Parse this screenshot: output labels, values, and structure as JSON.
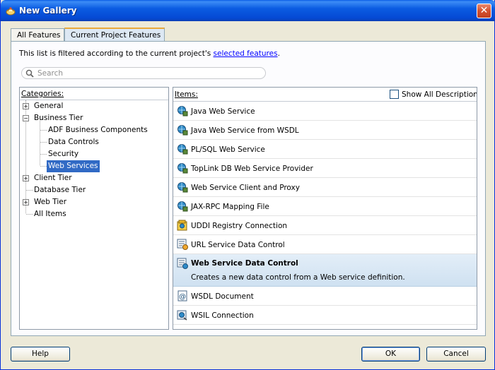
{
  "window": {
    "title": "New Gallery",
    "close_label": "✕"
  },
  "tabs": [
    {
      "label": "All Features",
      "selected": false
    },
    {
      "label": "Current Project Features",
      "selected": true
    }
  ],
  "filter_note": {
    "text": "This list is filtered according to the current project's ",
    "link": "selected features",
    "suffix": "."
  },
  "search": {
    "placeholder": "Search",
    "value": ""
  },
  "categories": {
    "header": "Categories:",
    "items": [
      {
        "label": "General",
        "level": 0,
        "expander": "+",
        "selected": false
      },
      {
        "label": "Business Tier",
        "level": 0,
        "expander": "−",
        "selected": false
      },
      {
        "label": "ADF Business Components",
        "level": 1,
        "expander": "",
        "selected": false
      },
      {
        "label": "Data Controls",
        "level": 1,
        "expander": "",
        "selected": false
      },
      {
        "label": "Security",
        "level": 1,
        "expander": "",
        "selected": false
      },
      {
        "label": "Web Services",
        "level": 1,
        "expander": "",
        "selected": true
      },
      {
        "label": "Client Tier",
        "level": 0,
        "expander": "+",
        "selected": false
      },
      {
        "label": "Database Tier",
        "level": 0,
        "expander": "",
        "selected": false
      },
      {
        "label": "Web Tier",
        "level": 0,
        "expander": "+",
        "selected": false
      },
      {
        "label": "All Items",
        "level": 0,
        "expander": "",
        "selected": false
      }
    ]
  },
  "items": {
    "header": "Items:",
    "show_all_descriptions": "Show All Descriptions",
    "show_all_checked": false,
    "list": [
      {
        "label": "Java Web Service",
        "icon": "web-service-icon"
      },
      {
        "label": "Java Web Service from WSDL",
        "icon": "web-service-icon"
      },
      {
        "label": "PL/SQL Web Service",
        "icon": "web-service-icon"
      },
      {
        "label": "TopLink DB Web Service Provider",
        "icon": "web-service-icon"
      },
      {
        "label": "Web Service Client and Proxy",
        "icon": "web-service-icon"
      },
      {
        "label": "JAX-RPC Mapping File",
        "icon": "web-service-icon"
      },
      {
        "label": "UDDI Registry Connection",
        "icon": "uddi-icon"
      },
      {
        "label": "URL Service Data Control",
        "icon": "data-control-icon"
      },
      {
        "label": "Web Service Data Control",
        "icon": "data-control-icon",
        "selected": true,
        "description": "Creates a new data control from a Web service definition."
      },
      {
        "label": "WSDL Document",
        "icon": "wsdl-icon"
      },
      {
        "label": "WSIL Connection",
        "icon": "wsil-icon"
      }
    ]
  },
  "buttons": {
    "help": "Help",
    "ok": "OK",
    "cancel": "Cancel"
  },
  "colors": {
    "title_bar": "#0b5ce2",
    "selection": "#316ac5",
    "selected_item_bg": "#d8e7f4",
    "link": "#0000ff"
  }
}
